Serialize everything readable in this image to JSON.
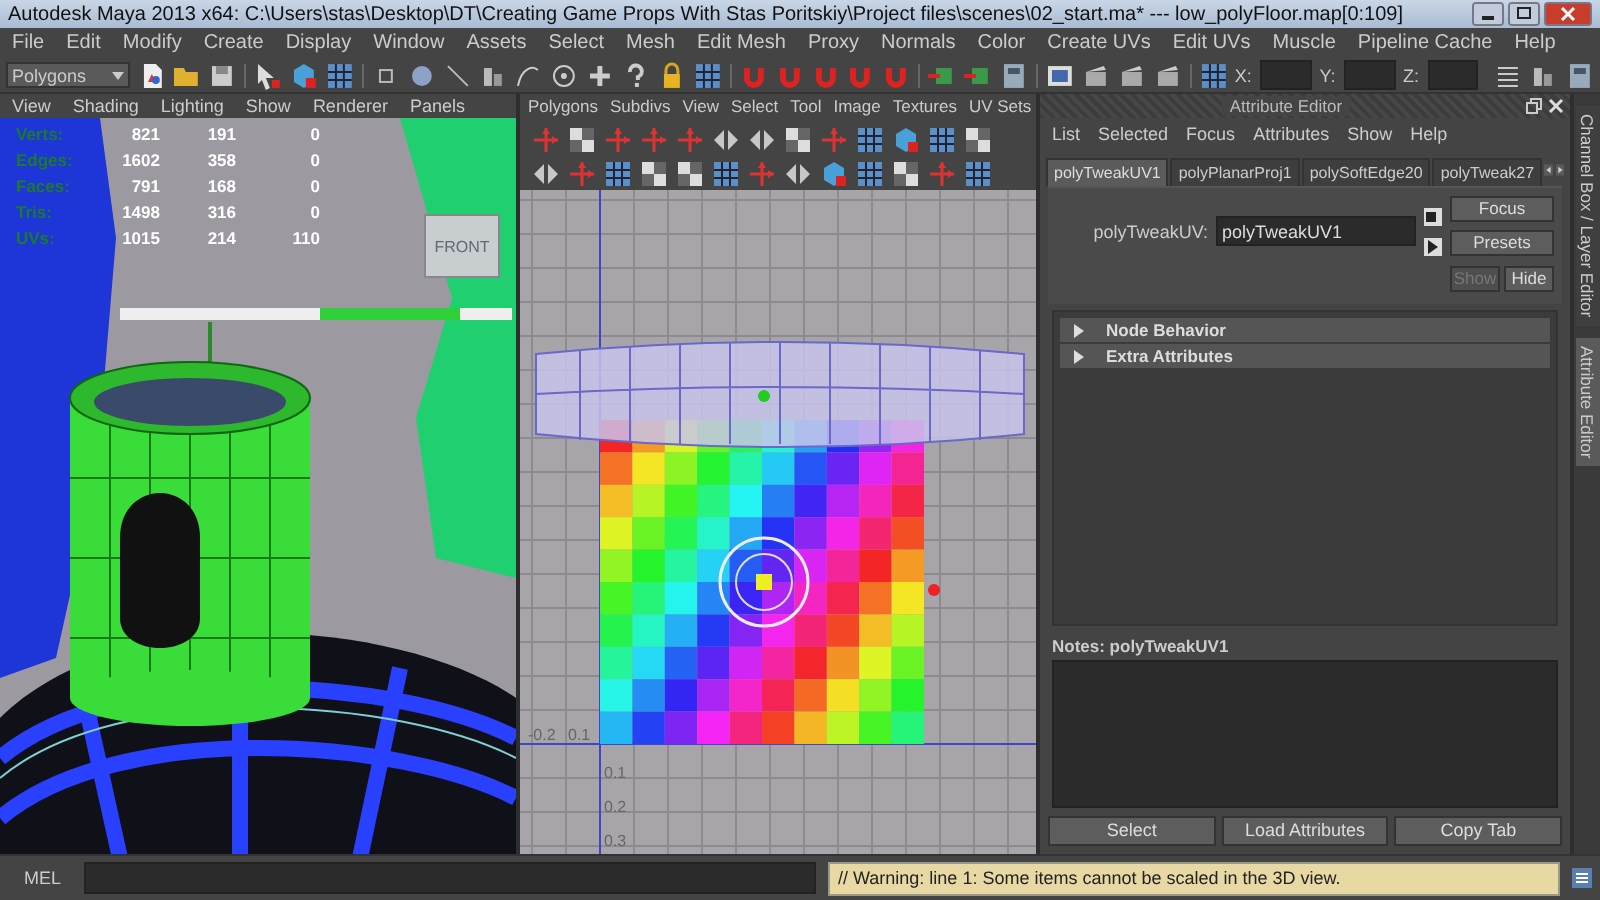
{
  "window": {
    "title": "Autodesk Maya 2013 x64: C:\\Users\\stas\\Desktop\\DT\\Creating Game Props With Stas Poritskiy\\Project files\\scenes\\02_start.ma*  ---  low_polyFloor.map[0:109]"
  },
  "menu_bar": [
    "File",
    "Edit",
    "Modify",
    "Create",
    "Display",
    "Window",
    "Assets",
    "Select",
    "Mesh",
    "Edit Mesh",
    "Proxy",
    "Normals",
    "Color",
    "Create UVs",
    "Edit UVs",
    "Muscle",
    "Pipeline Cache",
    "Help"
  ],
  "status_line": {
    "mode": "Polygons",
    "coord_labels": [
      "X:",
      "Y:",
      "Z:"
    ]
  },
  "viewport": {
    "menu": [
      "View",
      "Shading",
      "Lighting",
      "Show",
      "Renderer",
      "Panels"
    ],
    "hud": [
      {
        "label": "Verts:",
        "values": [
          "821",
          "191",
          "0"
        ]
      },
      {
        "label": "Edges:",
        "values": [
          "1602",
          "358",
          "0"
        ]
      },
      {
        "label": "Faces:",
        "values": [
          "791",
          "168",
          "0"
        ]
      },
      {
        "label": "Tris:",
        "values": [
          "1498",
          "316",
          "0"
        ]
      },
      {
        "label": "UVs:",
        "values": [
          "1015",
          "214",
          "110"
        ]
      }
    ],
    "view_cube_label": "FRONT"
  },
  "uv_editor": {
    "menu": [
      "Polygons",
      "Subdivs",
      "View",
      "Select",
      "Tool",
      "Image",
      "Textures",
      "UV Sets"
    ],
    "u_ticks": [
      "-0.2",
      "0.1"
    ],
    "v_ticks": [
      "0.1",
      "0.2",
      "0.3"
    ]
  },
  "attribute_editor": {
    "title": "Attribute Editor",
    "menu": [
      "List",
      "Selected",
      "Focus",
      "Attributes",
      "Show",
      "Help"
    ],
    "tabs": [
      {
        "label": "polyTweakUV1",
        "selected": true
      },
      {
        "label": "polyPlanarProj1",
        "selected": false
      },
      {
        "label": "polySoftEdge20",
        "selected": false
      },
      {
        "label": "polyTweak27",
        "selected": false
      }
    ],
    "field": {
      "label": "polyTweakUV:",
      "value": "polyTweakUV1"
    },
    "buttons": [
      {
        "label": "Focus",
        "disabled": false
      },
      {
        "label": "Presets",
        "disabled": false
      },
      {
        "label": "Show",
        "disabled": true
      },
      {
        "label": "Hide",
        "disabled": false
      }
    ],
    "sections": [
      {
        "label": "Node Behavior",
        "expanded": false
      },
      {
        "label": "Extra Attributes",
        "expanded": false
      }
    ],
    "notes_label": "Notes:  polyTweakUV1",
    "bottom_buttons": [
      "Select",
      "Load Attributes",
      "Copy Tab"
    ]
  },
  "side_tabs": [
    {
      "label": "Channel Box / Layer Editor",
      "selected": false
    },
    {
      "label": "Attribute Editor",
      "selected": true
    }
  ],
  "command_line": {
    "label": "MEL",
    "message": "// Warning: line 1: Some items cannot be scaled in the 3D view."
  }
}
